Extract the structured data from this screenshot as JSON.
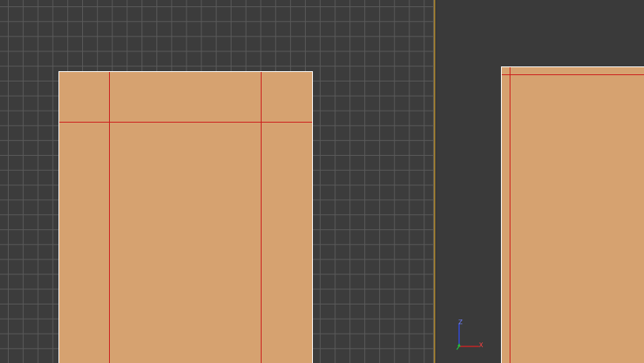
{
  "viewports": {
    "left": {
      "grid": true
    },
    "right": {
      "grid": false
    }
  },
  "colors": {
    "viewport_bg": "#3c3c3c",
    "grid_line": "#5a5a5a",
    "mesh_fill": "#d6a270",
    "edge_selected": "#cc1a1a",
    "active_divider": "#9a7a32",
    "axis_x": "#e02020",
    "axis_y": "#20c040",
    "axis_z": "#3050ff"
  },
  "axis_gizmo": {
    "z_label": "Z",
    "x_label": "X"
  }
}
